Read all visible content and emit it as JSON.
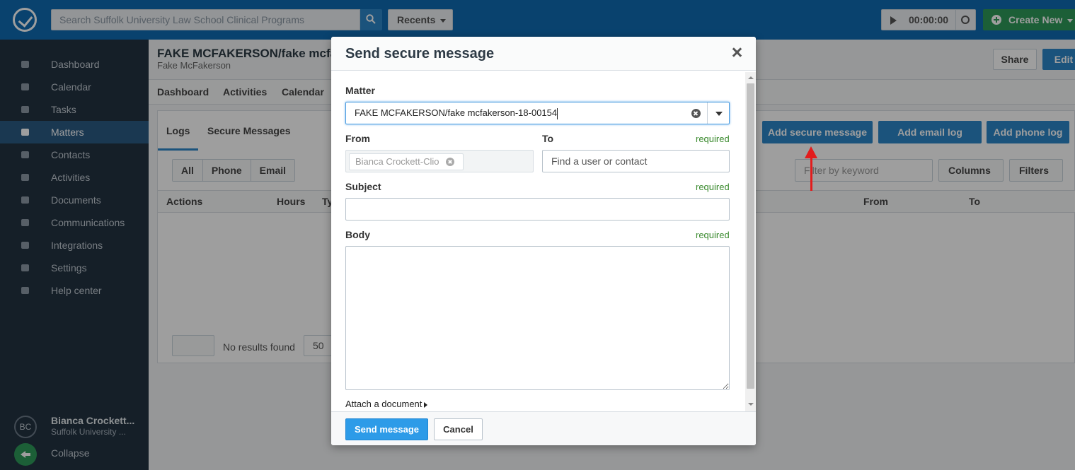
{
  "topbar": {
    "search_placeholder": "Search Suffolk University Law School Clinical Programs",
    "recents_label": "Recents",
    "timer_value": "00:00:00",
    "create_new_label": "Create New"
  },
  "sidebar": {
    "items": [
      {
        "label": "Dashboard",
        "icon": "home-icon"
      },
      {
        "label": "Calendar",
        "icon": "calendar-icon"
      },
      {
        "label": "Tasks",
        "icon": "tasks-icon"
      },
      {
        "label": "Matters",
        "icon": "briefcase-icon",
        "active": true
      },
      {
        "label": "Contacts",
        "icon": "user-icon"
      },
      {
        "label": "Activities",
        "icon": "clock-icon"
      },
      {
        "label": "Documents",
        "icon": "folder-icon"
      },
      {
        "label": "Communications",
        "icon": "phone-icon"
      },
      {
        "label": "Integrations",
        "icon": "sync-icon"
      },
      {
        "label": "Settings",
        "icon": "gear-icon"
      },
      {
        "label": "Help center",
        "icon": "help-icon"
      }
    ],
    "user": {
      "initials": "BC",
      "name": "Bianca Crockett...",
      "org": "Suffolk University ..."
    },
    "collapse_label": "Collapse"
  },
  "matter": {
    "title": "FAKE MCFAKERSON/fake mcfak",
    "subtitle": "Fake McFakerson",
    "share_label": "Share",
    "edit_label": "Edit",
    "subnav": [
      "Dashboard",
      "Activities",
      "Calendar"
    ]
  },
  "communications": {
    "tabs": [
      "Logs",
      "Secure Messages"
    ],
    "actions": {
      "add_secure_message": "Add secure message",
      "add_email_log": "Add email log",
      "add_phone_log": "Add phone log"
    },
    "filters": [
      "All",
      "Phone",
      "Email"
    ],
    "keyword_placeholder": "Filter by keyword",
    "columns_label": "Columns",
    "filters_label": "Filters",
    "table_headers": {
      "actions": "Actions",
      "hours": "Hours",
      "type": "Ty",
      "from": "From",
      "to": "To"
    },
    "no_results": "No results found",
    "per_page": "50"
  },
  "modal": {
    "title": "Send secure message",
    "matter_label": "Matter",
    "matter_value": "FAKE MCFAKERSON/fake mcfakerson-18-00154",
    "from_label": "From",
    "from_value": "Bianca Crockett-Clio",
    "to_label": "To",
    "to_required": "required",
    "to_placeholder": "Find a user or contact",
    "subject_label": "Subject",
    "subject_required": "required",
    "subject_value": "",
    "body_label": "Body",
    "body_required": "required",
    "body_value": "",
    "attach_label": "Attach a document",
    "send_label": "Send message",
    "cancel_label": "Cancel"
  },
  "colors": {
    "topbar": "#0f6bb2",
    "sidebar": "#223241",
    "primary": "#2d86c8",
    "required": "#3a8a2e",
    "annotation_arrow": "#e31c1c"
  }
}
